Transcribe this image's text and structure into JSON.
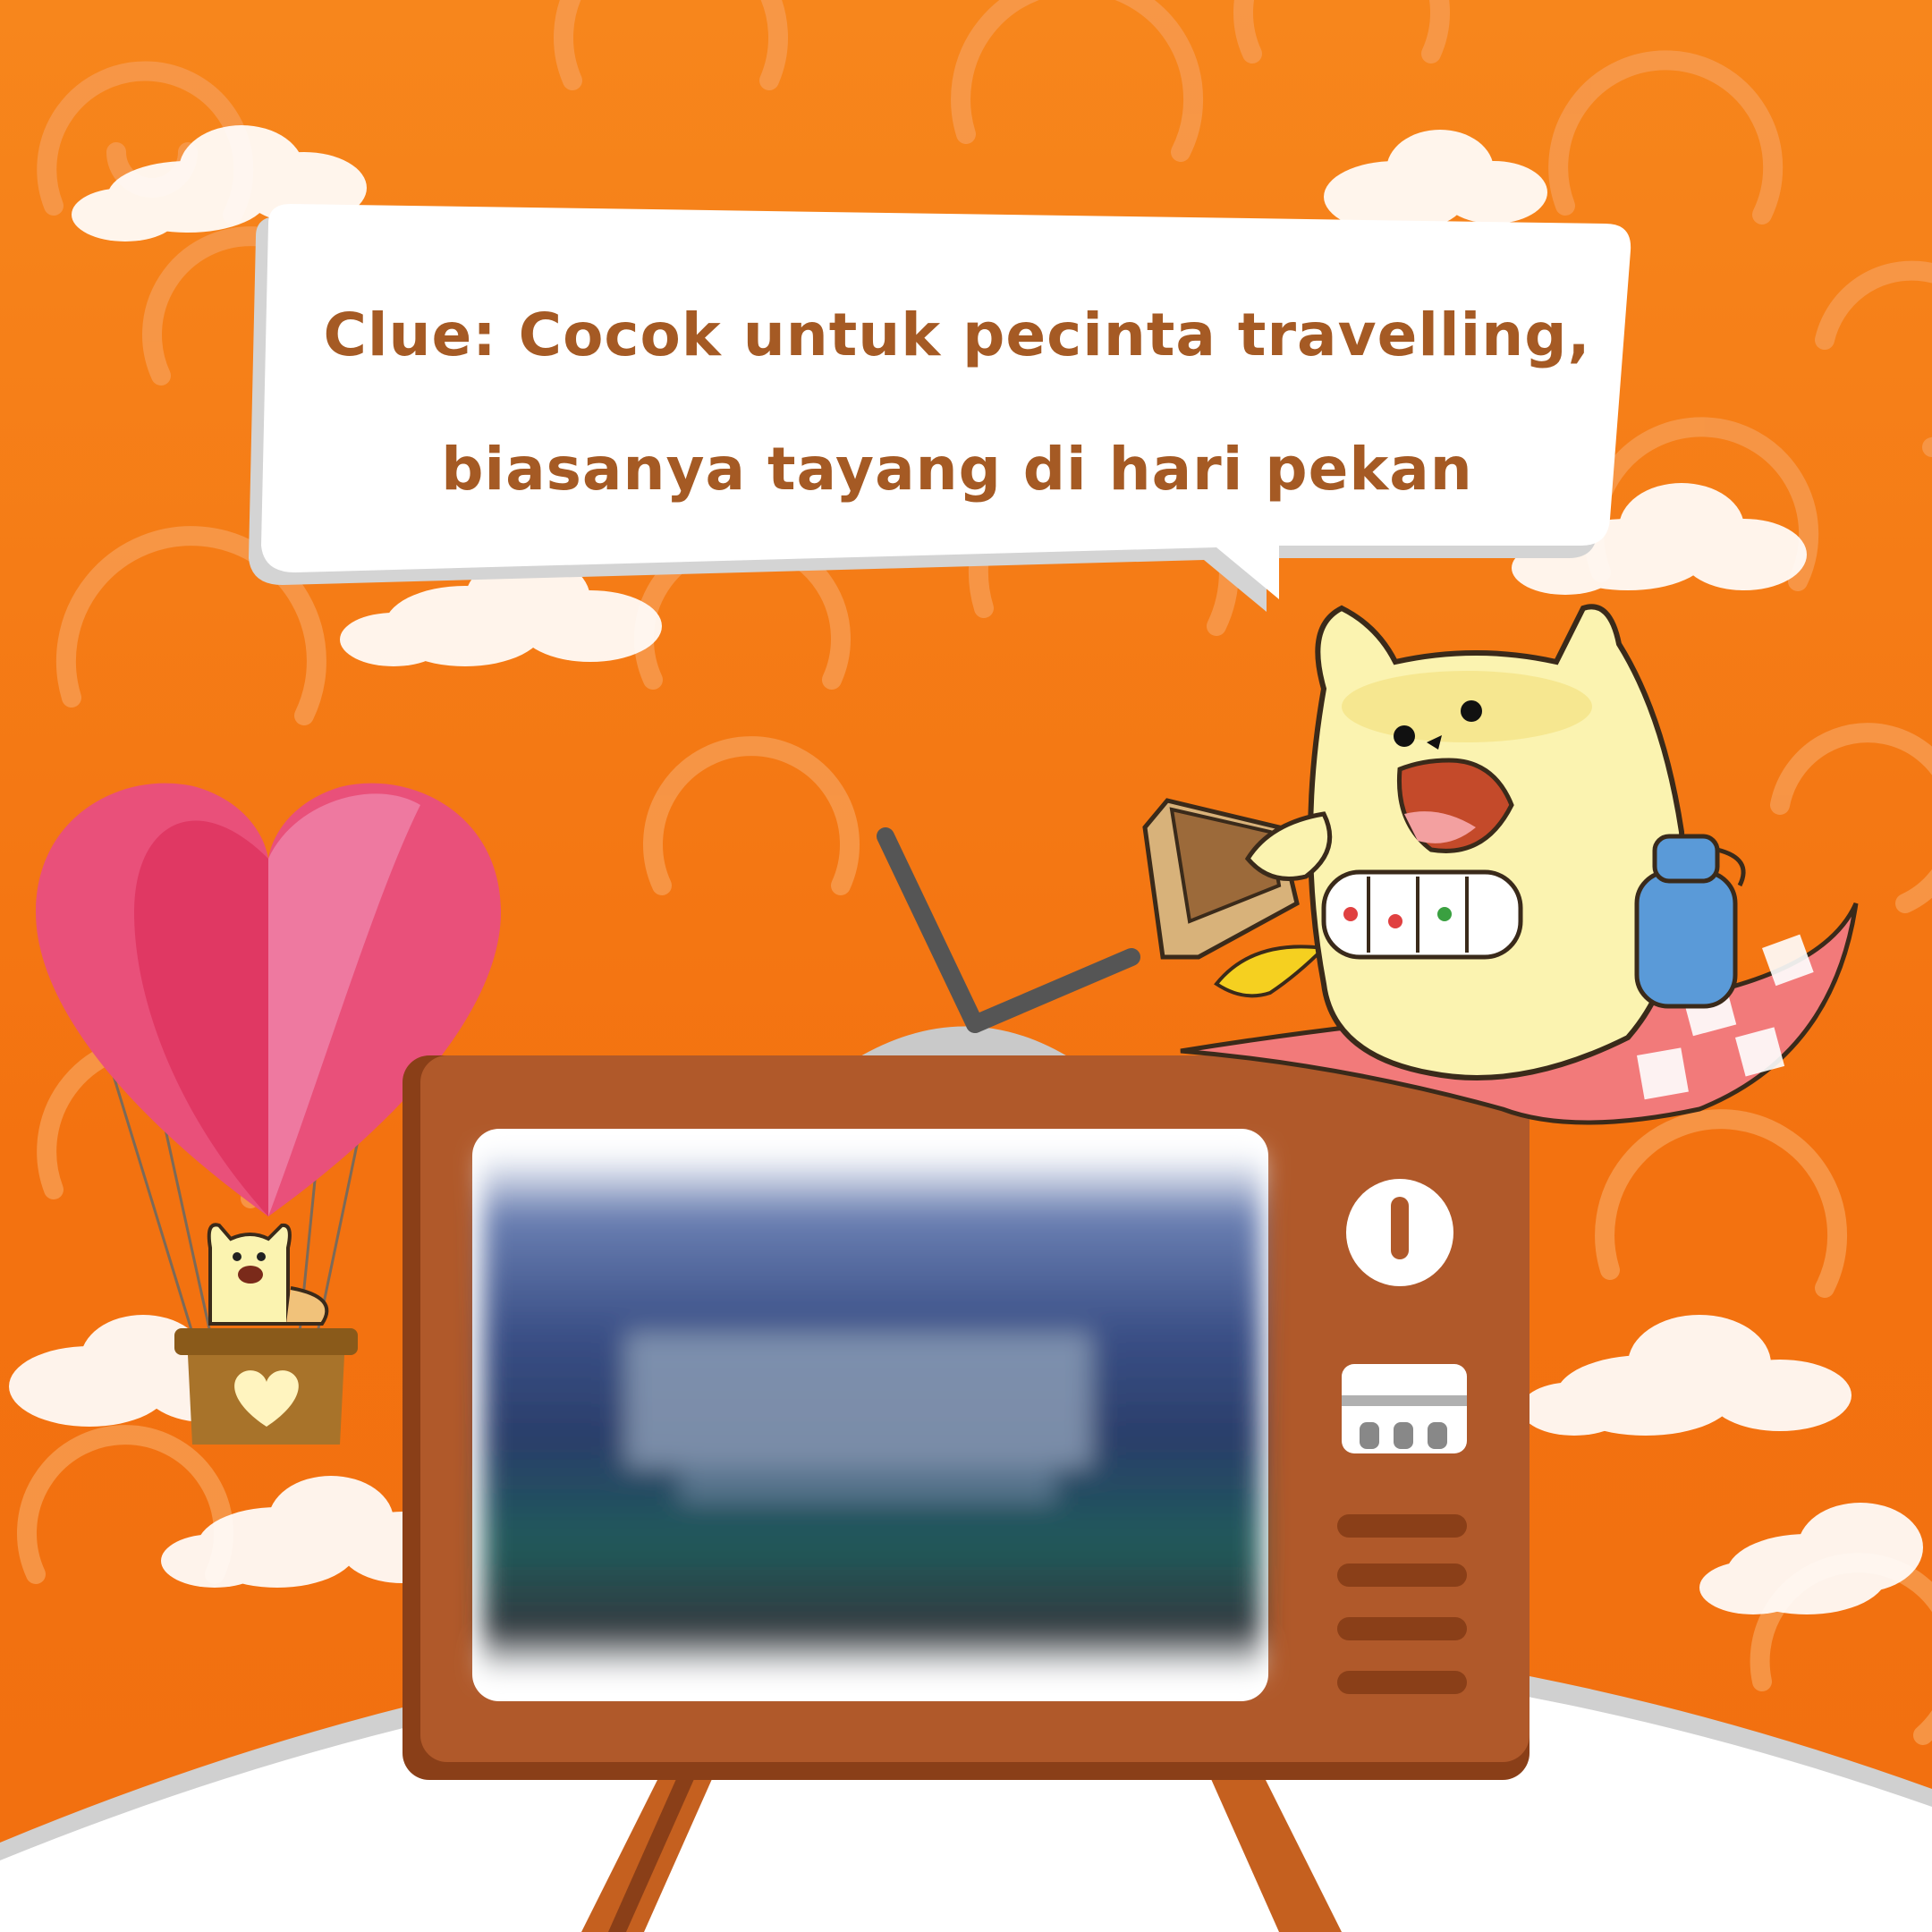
{
  "speech_bubble": {
    "line1": "Clue: Cocok untuk pecinta travelling,",
    "line2": "biasanya tayang di hari pekan"
  },
  "colors": {
    "background": "#f57a12",
    "pattern": "#f79545",
    "bubble": "#ffffff",
    "bubble_shadow": "#d9d9d9",
    "text": "#a55a24",
    "tv_body": "#b0592a",
    "tv_dark": "#8a3f18",
    "balloon_pink": "#e9507a",
    "mascot": "#fbf3b0",
    "ground": "#ffffff"
  },
  "icons": {
    "mascot_main": "cat-mascot-icon",
    "mascot_small": "cat-mascot-small-icon",
    "balloon": "heart-balloon-icon",
    "basket": "picnic-basket-icon",
    "bottle": "water-bottle-icon",
    "lunchbox": "tiffin-box-icon",
    "tv": "retro-tv-icon"
  }
}
